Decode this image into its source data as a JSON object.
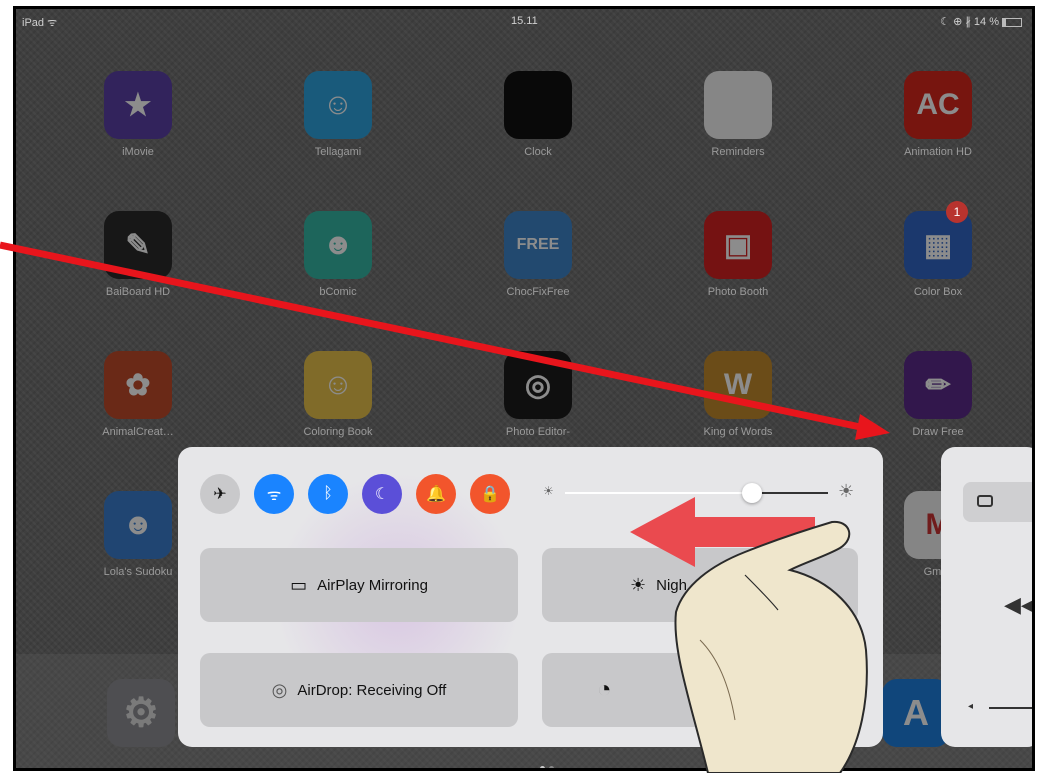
{
  "status_bar": {
    "device": "iPad ᯤ",
    "time": "15.11",
    "battery": "☾ ⊕ ∦ 14 %"
  },
  "apps": [
    {
      "name": "iMovie",
      "icon": "imovie-icon",
      "color": "#5b3fa8",
      "glyph": "★"
    },
    {
      "name": "Tellagami",
      "icon": "tellagami-icon",
      "color": "#2ea4e0",
      "glyph": "☺"
    },
    {
      "name": "Clock",
      "icon": "clock-icon",
      "color": "#111111",
      "glyph": ""
    },
    {
      "name": "Reminders",
      "icon": "reminders-icon",
      "color": "#f4f4f4",
      "glyph": ""
    },
    {
      "name": "Animation HD",
      "icon": "animation-hd-icon",
      "color": "#d9261c",
      "glyph": "AC"
    },
    {
      "name": "BaiBoard HD",
      "icon": "baiboard-icon",
      "color": "#2a2a2a",
      "glyph": "✎"
    },
    {
      "name": "bComic",
      "icon": "bcomic-icon",
      "color": "#35b7a5",
      "glyph": "☻"
    },
    {
      "name": "ChocFixFree",
      "icon": "chocfix-icon",
      "color": "#3d84c9",
      "glyph": "FREE"
    },
    {
      "name": "Photo Booth",
      "icon": "photo-booth-icon",
      "color": "#d42020",
      "glyph": "▣"
    },
    {
      "name": "Color Box",
      "icon": "color-box-icon",
      "color": "#3166c6",
      "glyph": "▦"
    },
    {
      "name": "AnimalCreat…",
      "icon": "animal-creator-icon",
      "color": "#c04a2a",
      "glyph": "✿"
    },
    {
      "name": "Coloring Book",
      "icon": "coloring-book-icon",
      "color": "#e9c24a",
      "glyph": "☺"
    },
    {
      "name": "Photo Editor-",
      "icon": "photo-editor-icon",
      "color": "#1c1c1c",
      "glyph": "◎"
    },
    {
      "name": "King of Words",
      "icon": "king-of-words-icon",
      "color": "#c28a2c",
      "glyph": "W"
    },
    {
      "name": "Draw Free",
      "icon": "draw-free-icon",
      "color": "#5a2a8a",
      "glyph": "✏"
    },
    {
      "name": "Lola's Sudoku",
      "icon": "lolas-sudoku-icon",
      "color": "#3b7ed0",
      "glyph": "☻"
    },
    {
      "name": "Gmail",
      "icon": "gmail-icon",
      "color": "#f2f2f2",
      "glyph": "M"
    }
  ],
  "badges": {
    "color_box": "1"
  },
  "control_center": {
    "toggles": [
      {
        "name": "airplane-mode-toggle",
        "icon": "airplane-icon",
        "glyph": "✈",
        "color": "#c9c9cb",
        "fg": "#111111"
      },
      {
        "name": "wifi-toggle",
        "icon": "wifi-icon",
        "glyph": "ᯤ",
        "color": "#1a84ff",
        "fg": "#ffffff"
      },
      {
        "name": "bluetooth-toggle",
        "icon": "bluetooth-icon",
        "glyph": "ᛒ",
        "color": "#1a84ff",
        "fg": "#ffffff"
      },
      {
        "name": "do-not-disturb-toggle",
        "icon": "moon-icon",
        "glyph": "☾",
        "color": "#5b4fd8",
        "fg": "#ffffff"
      },
      {
        "name": "mute-toggle",
        "icon": "bell-icon",
        "glyph": "🔔",
        "color": "#f2552c",
        "fg": "#ffffff"
      },
      {
        "name": "rotation-lock-toggle",
        "icon": "rotation-lock-icon",
        "glyph": "🔒",
        "color": "#f2552c",
        "fg": "#ffffff"
      }
    ],
    "brightness": 0.71,
    "airplay_label": "AirPlay Mirroring",
    "airdrop_label": "AirDrop: Receiving Off",
    "night_label": "Nigh"
  },
  "colors": {
    "accent_blue": "#1a84ff",
    "accent_orange": "#f2552c",
    "accent_purple": "#5b4fd8",
    "arrow_red": "#e8151c"
  }
}
